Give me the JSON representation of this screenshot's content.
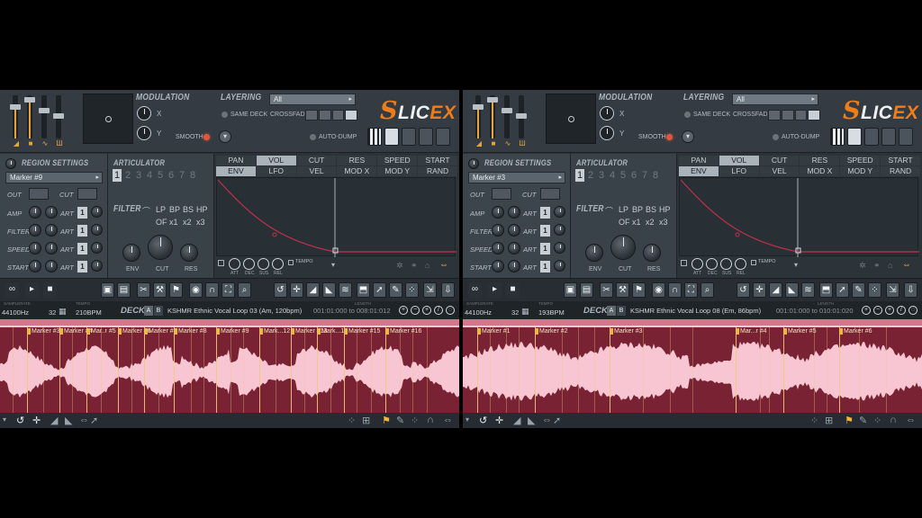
{
  "panels": [
    {
      "modulation": {
        "label": "MODULATION",
        "x": "X",
        "y": "Y",
        "smooth": "SMOOTH"
      },
      "layering": {
        "label": "LAYERING",
        "dropdown": "All",
        "same_deck": "SAME DECK",
        "crossfade": "CROSSFADE",
        "auto_dump": "AUTO-DUMP"
      },
      "logo": {
        "s": "S",
        "lic": "LIC",
        "ex": "EX"
      },
      "region": {
        "title": "REGION SETTINGS",
        "marker": "Marker #9",
        "out": "OUT",
        "cut": "CUT",
        "amp": "AMP",
        "filter": "FILTER",
        "speed": "SPEED",
        "start": "START",
        "art": "ART",
        "one": "1"
      },
      "articulator": {
        "title": "ARTICULATOR",
        "numbers": [
          "1",
          "2",
          "3",
          "4",
          "5",
          "6",
          "7",
          "8"
        ],
        "filter": "FILTER",
        "lp": "LP",
        "bp": "BP",
        "bs": "BS",
        "hp": "HP",
        "of": "OF",
        "x1": "x1",
        "x2": "x2",
        "x3": "x3",
        "env": "ENV",
        "cut": "CUT",
        "res": "RES"
      },
      "tabs_row1": [
        "PAN",
        "VOL",
        "CUT",
        "RES",
        "SPEED",
        "START"
      ],
      "tabs_row2": [
        "ENV",
        "LFO",
        "VEL",
        "MOD X",
        "MOD Y",
        "RAND"
      ],
      "env_knobs": [
        "ATT",
        "DEC",
        "SUS",
        "REL"
      ],
      "tempo": "TEMPO",
      "info": {
        "samplerate_lbl": "SAMPLERATE",
        "samplerate": "44100Hz",
        "bits": "32",
        "tempo_lbl": "TEMPO",
        "tempo": "210BPM",
        "deck": "DECK",
        "a": "A",
        "b": "B",
        "sample": "KSHMR Ethnic Vocal Loop 03 (Am, 120bpm)",
        "range": "001:01:000 to 008:01:012",
        "length_lbl": "LENGTH"
      },
      "markers": [
        "Marker #3",
        "Marker #4",
        "Mar..r #5",
        "Marker #6",
        "Marker #7",
        "Marker #8",
        "Marker #9",
        "Mark...12",
        "Marker #13",
        "Mark...14",
        "Marker #15",
        "Marker #16"
      ]
    },
    {
      "modulation": {
        "label": "MODULATION",
        "x": "X",
        "y": "Y",
        "smooth": "SMOOTH"
      },
      "layering": {
        "label": "LAYERING",
        "dropdown": "All",
        "same_deck": "SAME DECK",
        "crossfade": "CROSSFADE",
        "auto_dump": "AUTO-DUMP"
      },
      "logo": {
        "s": "S",
        "lic": "LIC",
        "ex": "EX"
      },
      "region": {
        "title": "REGION SETTINGS",
        "marker": "Marker #3",
        "out": "OUT",
        "cut": "CUT",
        "amp": "AMP",
        "filter": "FILTER",
        "speed": "SPEED",
        "start": "START",
        "art": "ART",
        "one": "1"
      },
      "articulator": {
        "title": "ARTICULATOR",
        "numbers": [
          "1",
          "2",
          "3",
          "4",
          "5",
          "6",
          "7",
          "8"
        ],
        "filter": "FILTER",
        "lp": "LP",
        "bp": "BP",
        "bs": "BS",
        "hp": "HP",
        "of": "OF",
        "x1": "x1",
        "x2": "x2",
        "x3": "x3",
        "env": "ENV",
        "cut": "CUT",
        "res": "RES"
      },
      "tabs_row1": [
        "PAN",
        "VOL",
        "CUT",
        "RES",
        "SPEED",
        "START"
      ],
      "tabs_row2": [
        "ENV",
        "LFO",
        "VEL",
        "MOD X",
        "MOD Y",
        "RAND"
      ],
      "env_knobs": [
        "ATT",
        "DEC",
        "SUS",
        "REL"
      ],
      "tempo": "TEMPO",
      "info": {
        "samplerate_lbl": "SAMPLERATE",
        "samplerate": "44100Hz",
        "bits": "32",
        "tempo_lbl": "TEMPO",
        "tempo": "193BPM",
        "deck": "DECK",
        "a": "A",
        "b": "B",
        "sample": "KSHMR Ethnic Vocal Loop 08 (Em, 86bpm)",
        "range": "001:01:000 to 010:01:020",
        "length_lbl": "LENGTH"
      },
      "markers": [
        "Marker #1",
        "Marker #2",
        "Marker #3",
        "Mar...r #4",
        "Marker #5",
        "Marker #6"
      ]
    }
  ],
  "colors": {
    "accent": "#ef7d1a",
    "waveform_bg": "#782234",
    "waveform": "#f7c6d2",
    "marker": "#f2b63a",
    "env_curve": "#c0304a"
  }
}
